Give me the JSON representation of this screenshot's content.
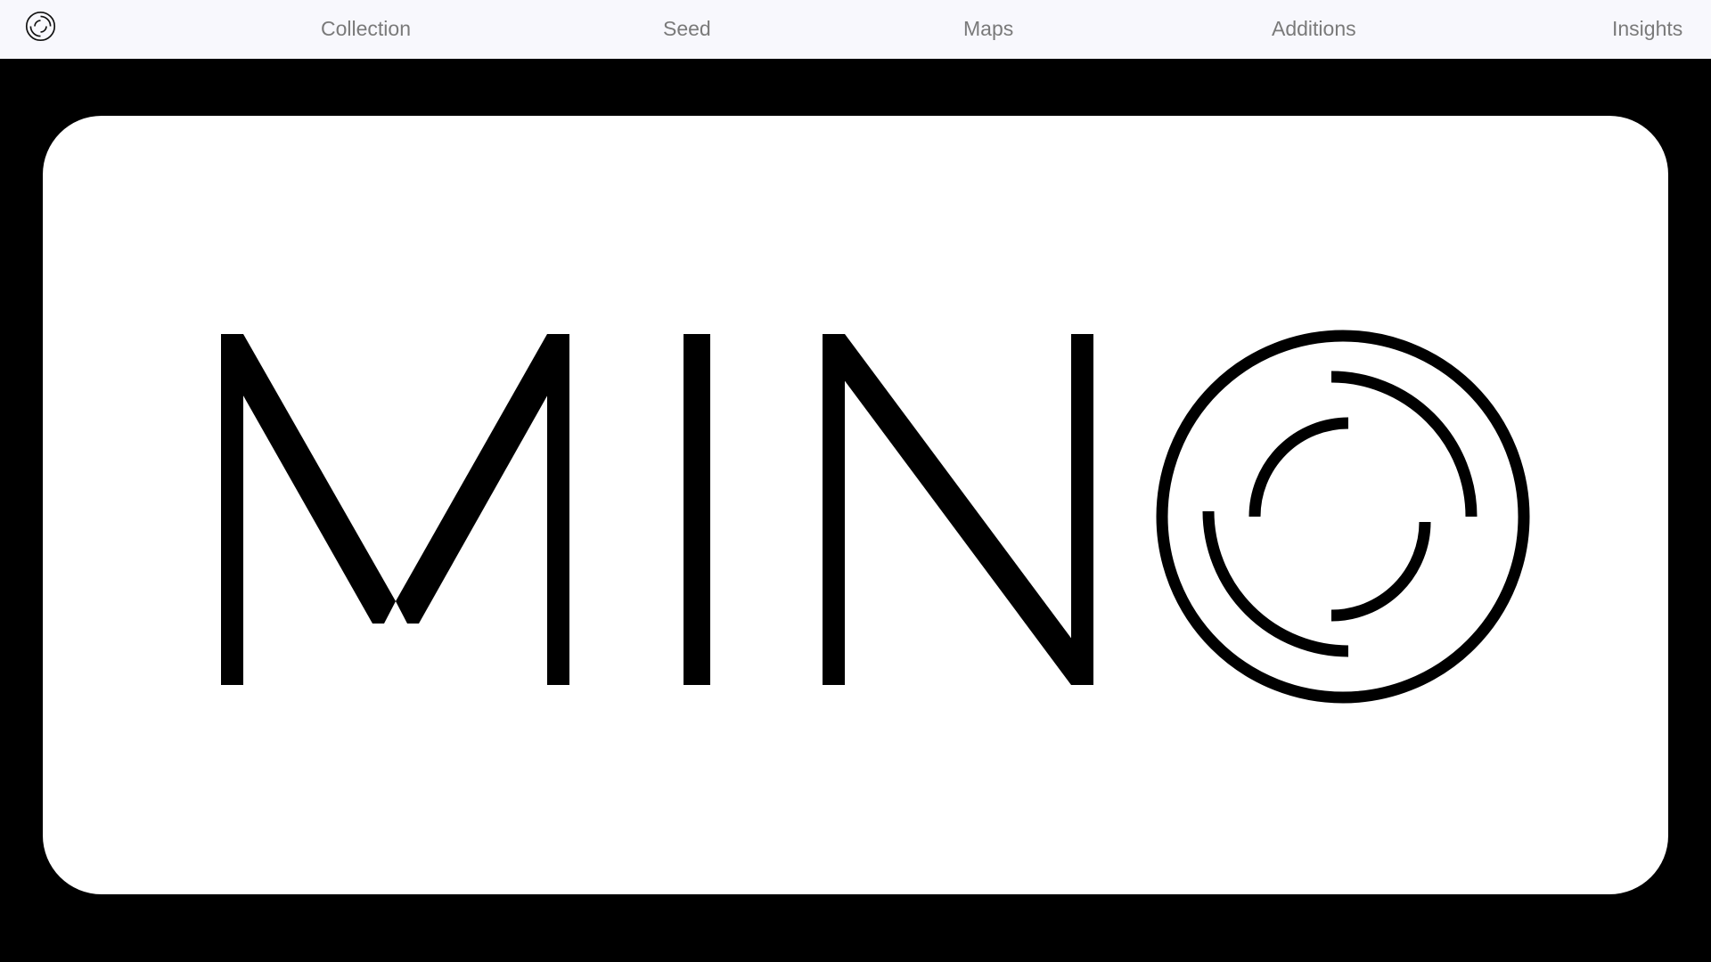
{
  "nav": {
    "logo_icon": "mino-logo-icon",
    "links": [
      {
        "label": "Collection"
      },
      {
        "label": "Seed"
      },
      {
        "label": "Maps"
      },
      {
        "label": "Additions"
      },
      {
        "label": "Insights"
      }
    ]
  },
  "hero": {
    "wordmark": "MINO",
    "logo_icon": "concentric-arcs-o-icon"
  },
  "colors": {
    "nav_background": "#f8f8fd",
    "nav_text": "#7a7a7a",
    "page_background": "#000000",
    "card_background": "#ffffff",
    "ink": "#000000"
  }
}
